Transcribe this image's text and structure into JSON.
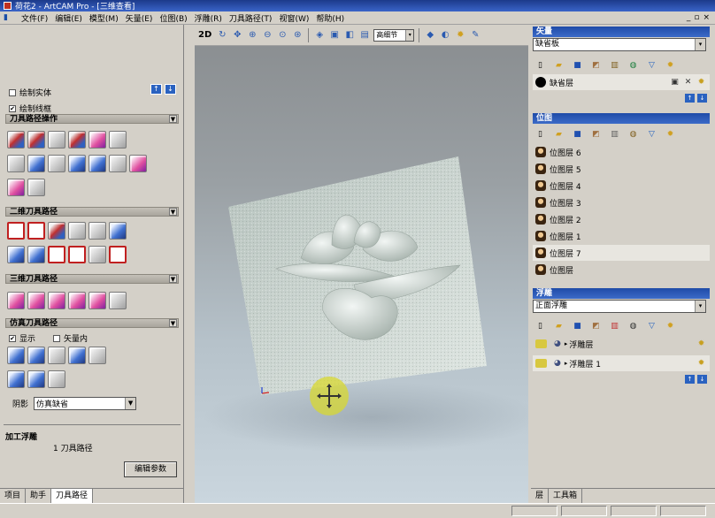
{
  "window": {
    "title": "荷花2 - ArtCAM Pro - [三维查看]"
  },
  "menu": {
    "items": [
      "文件(F)",
      "编辑(E)",
      "模型(M)",
      "矢量(E)",
      "位图(B)",
      "浮雕(R)",
      "刀具路径(T)",
      "视窗(W)",
      "帮助(H)"
    ],
    "mdi_minimize": "_",
    "mdi_restore": "▫",
    "mdi_close": "×"
  },
  "left": {
    "draw_solid": "绘制实体",
    "draw_wireframe": "绘制线框",
    "nav_up": "↑",
    "nav_down": "↓",
    "sections": {
      "toolpath_ops": "刀具路径操作",
      "toolpath_2d": "二维刀具路径",
      "toolpath_3d": "三维刀具路径",
      "simulation": "仿真刀具路径"
    },
    "collapse_glyph": "▼",
    "show_label": "显示",
    "vector_inner_label": "矢量内",
    "shade_label": "阴影",
    "shade_value": "仿真缺省",
    "machine_relief": "加工浮雕",
    "toolpath_count": "1 刀具路径",
    "edit_params": "编辑参数",
    "tabs": [
      "项目",
      "助手",
      "刀具路径"
    ]
  },
  "viewport": {
    "mode_2d": "2D",
    "detail_value": "高细节",
    "dropdown_glyph": "▾"
  },
  "right": {
    "vectors": {
      "header": "矢量",
      "select_value": "缺省板",
      "layers": [
        {
          "name": "缺省层"
        }
      ]
    },
    "bitmaps": {
      "header": "位图",
      "layers": [
        {
          "name": "位图层 6"
        },
        {
          "name": "位图层 5"
        },
        {
          "name": "位图层 4"
        },
        {
          "name": "位图层 3"
        },
        {
          "name": "位图层 2"
        },
        {
          "name": "位图层 1"
        },
        {
          "name": "位图层 7"
        },
        {
          "name": "位图层"
        }
      ]
    },
    "reliefs": {
      "header": "浮雕",
      "select_value": "正面浮雕",
      "layers": [
        {
          "name": "浮雕层"
        },
        {
          "name": "浮雕层 1"
        }
      ]
    },
    "tabs": [
      "层",
      "工具箱"
    ]
  },
  "colors": {
    "title_bar": "#2a4fa8",
    "panel_header": "#2a58b8",
    "gizmo": "#d8d830"
  },
  "icons": [
    "pan-icon",
    "zoom-in-icon",
    "zoom-out-icon",
    "zoom-box-icon",
    "iso-view-icon",
    "top-view-icon",
    "bulb-icon",
    "move-gizmo-icon"
  ]
}
